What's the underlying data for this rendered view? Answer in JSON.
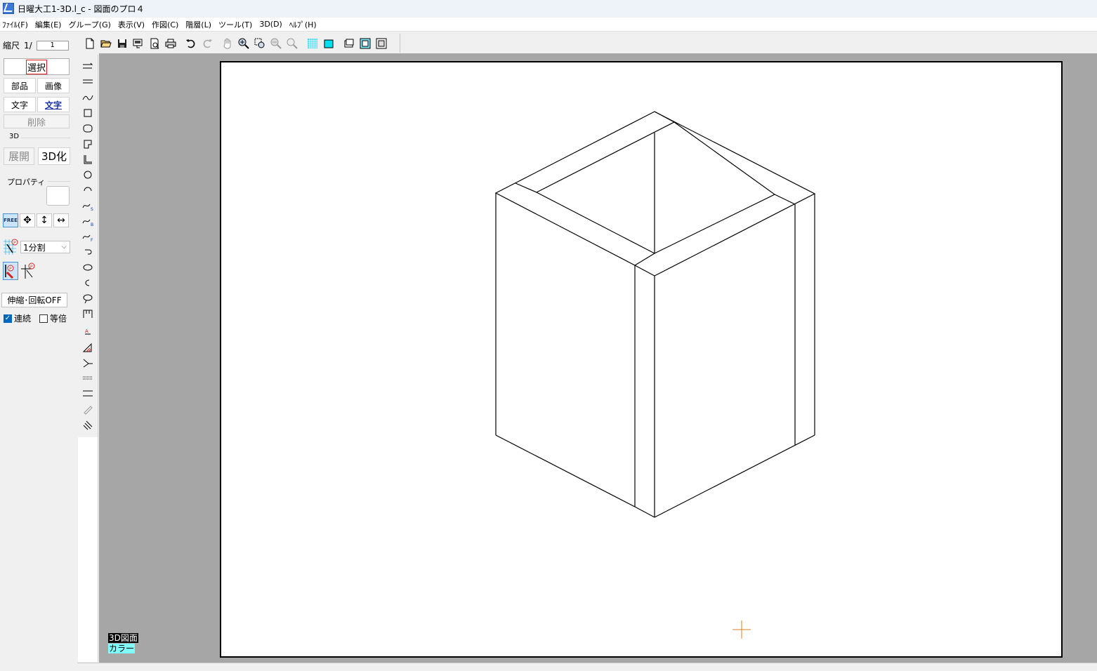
{
  "window": {
    "title": "日曜大工1-3D.l_c - 図面のプロ４"
  },
  "menu": [
    {
      "label": "ﾌｧｲﾙ(F)"
    },
    {
      "label": "編集(E)"
    },
    {
      "label": "グループ(G)"
    },
    {
      "label": "表示(V)"
    },
    {
      "label": "作図(C)"
    },
    {
      "label": "階層(L)"
    },
    {
      "label": "ツール(T)"
    },
    {
      "label": "3D(D)"
    },
    {
      "label": "ﾍﾙﾌﾟ(H)"
    }
  ],
  "left_panel": {
    "scale_label": "縮尺",
    "scale_prefix": "1/",
    "scale_value": "1",
    "select_button": "選択",
    "parts_button": "部品",
    "image_button": "画像",
    "text_button": "文字",
    "text_style_button": "文字",
    "delete_button": "削除",
    "group_3d_label": "3D",
    "expand_button": "展開",
    "to3d_button": "3D化",
    "property_label": "プロパティ",
    "free_button": "FREE",
    "division_select": "1分割",
    "resize_rotate_button": "伸縮･回転OFF",
    "continuous_label": "連続",
    "continuous_checked": true,
    "equal_scale_label": "等倍",
    "equal_scale_checked": false
  },
  "canvas": {
    "mode_label_1": "3D図面",
    "mode_label_2": "カラー",
    "accent_colors": {
      "mode_label_1_bg": "#000000",
      "mode_label_2_bg": "#7fffff",
      "cursor": "#e08020"
    }
  }
}
